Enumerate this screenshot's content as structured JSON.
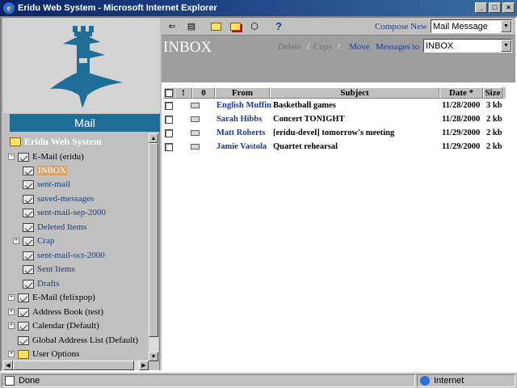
{
  "window": {
    "title": "Eridu Web System - Microsoft Internet Explorer",
    "buttons": [
      "_",
      "□",
      "×"
    ]
  },
  "sidebar": {
    "app_label": "Mail",
    "system_name": "Eridu Web System",
    "tree": [
      {
        "label": "E-Mail (eridu)",
        "expander": "−",
        "icon": "mailbox"
      },
      {
        "label": "INBOX",
        "icon": "mail-folder",
        "selected": true
      },
      {
        "label": "sent-mail",
        "icon": "mail-folder"
      },
      {
        "label": "saved-messages",
        "icon": "mail-folder"
      },
      {
        "label": "sent-mail-sep-2000",
        "icon": "mail-folder"
      },
      {
        "label": "Deleted Items",
        "icon": "mail-folder"
      },
      {
        "label": "Crap",
        "expander": "+",
        "icon": "mail-folder"
      },
      {
        "label": "sent-mail-oct-2000",
        "icon": "mail-folder"
      },
      {
        "label": "Sent Items",
        "icon": "mail-folder"
      },
      {
        "label": "Drafts",
        "icon": "mail-folder"
      },
      {
        "label": "E-Mail (felixpop)",
        "expander": "+",
        "icon": "mailbox"
      },
      {
        "label": "Address Book (test)",
        "expander": "+",
        "icon": "address-book"
      },
      {
        "label": "Calendar (Default)",
        "expander": "+",
        "icon": "calendar"
      },
      {
        "label": "Global Address List (Default)",
        "icon": "address-book"
      },
      {
        "label": "User Options",
        "expander": "+",
        "icon": "folder"
      }
    ]
  },
  "header": {
    "compose_label": "Compose New",
    "compose_type": "Mail Message",
    "folder_title": "INBOX",
    "actions": {
      "delete": "Delete",
      "copy": "Copy",
      "move": "Move",
      "messages_to": "Messages to",
      "sep": "/"
    },
    "target_folder": "INBOX",
    "toolbar_icons": [
      "reply-icon",
      "forward-icon",
      "new-folder-icon",
      "rename-folder-icon",
      "empty-trash-icon",
      "help-icon"
    ],
    "help_glyph": "?"
  },
  "table": {
    "columns": {
      "from": "From",
      "subject": "Subject",
      "date": "Date *",
      "size": "Size",
      "priority": "!",
      "attach": "0"
    },
    "rows": [
      {
        "from": "English Muffin",
        "subject": "Basketball games",
        "date": "11/28/2000",
        "size": "3 kb"
      },
      {
        "from": "Sarah Hibbs",
        "subject": "Concert TONIGHT",
        "date": "11/28/2000",
        "size": "2 kb"
      },
      {
        "from": "Matt Roberts",
        "subject": "[eridu-devel] tomorrow's meeting",
        "date": "11/29/2000",
        "size": "2 kb"
      },
      {
        "from": "Jamie Vastola",
        "subject": "Quartet rehearsal",
        "date": "11/29/2000",
        "size": "2 kb"
      }
    ]
  },
  "status": {
    "text": "Done",
    "zone": "Internet"
  },
  "colors": {
    "titlebar": "#0a246a",
    "mail_banner": "#1e6e99",
    "logo": "#1e6e99",
    "link": "#1c3a9a",
    "selection": "#d8a36a"
  }
}
